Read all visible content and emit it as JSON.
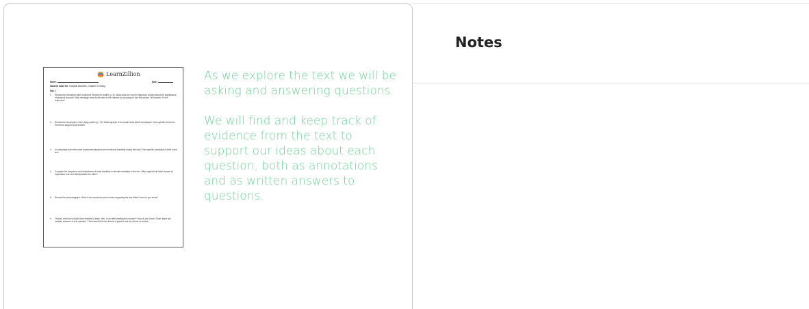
{
  "slide": {
    "worksheet": {
      "brand": "LearnZillion",
      "name_label": "Name:",
      "date_label": "Date:",
      "student_notes_for_label": "Student notes for:",
      "student_notes_for_value": "Hospital Sketches, Chapter III: A Day",
      "day_label": "Day 1",
      "questions": [
        {
          "num": "1.",
          "text": "Reread the interaction with Josephine Shimmel's soldier (p. 5). What does the nurse's response convey about the significance of physical wounds? Why message does Alcott want to the readers by choosing to use the phrase \"all wounds\" in her response?"
        },
        {
          "num": "2.",
          "text": "Reread the description of the dying soldier (p. 12). What aspects of his death does Alcott emphasize? Use specific lines from the text to support your answer."
        },
        {
          "num": "3.",
          "text": "In what ways does the nurse experience physical and emotional hardship during her day? Find specific examples of both in the text."
        },
        {
          "num": "4.",
          "text": "Compare the frequency and explicitness of male hardship to female hardships in the text. Why might Alcott have chosen to emphasize one and deemphasize the other?"
        },
        {
          "num": "5.",
          "text": "Reread the last paragraph. What is the narrator's point of view regarding the war effort? How do you know?"
        },
        {
          "num": "6.",
          "text": "Overall, what does Alcott want readers to learn, feel, or do after reading this excerpt? How do you know? Note: there are multiple answers to this question. Think about both the theme of gender and the theme of service."
        }
      ]
    },
    "paragraphs": [
      "As we explore the text we will be asking and answering questions.",
      "We will find and keep track of evidence from the text to support our ideas about each question, both as annotations and as written answers to questions."
    ]
  },
  "notes": {
    "title": "Notes"
  },
  "colors": {
    "accent_text": "#6fcf9a",
    "card_border": "#c9c9c9"
  }
}
